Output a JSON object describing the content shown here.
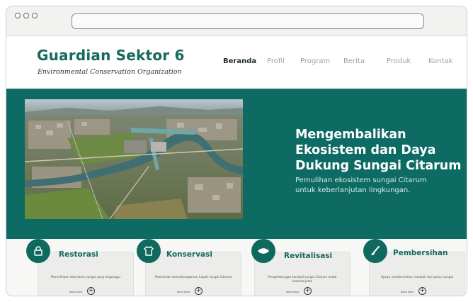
{
  "brand": {
    "title": "Guardian Sektor 6",
    "subtitle": "Environmental Conservation Organization",
    "accent_color": "#17695e"
  },
  "nav": {
    "items": [
      {
        "label": "Beranda",
        "active": true
      },
      {
        "label": "Profil",
        "active": false
      },
      {
        "label": "Program",
        "active": false
      },
      {
        "label": "Berita",
        "active": false
      },
      {
        "label": "Produk",
        "active": false
      },
      {
        "label": "Kontak",
        "active": false
      }
    ]
  },
  "hero": {
    "background_color": "#0d6b64",
    "image_subject": "aerial view of river and city",
    "title_lines": [
      "Mengembalikan",
      "Ekosistem dan Daya",
      "Dukung Sungai Citarum"
    ],
    "subtitle_lines": [
      "Pemulihan ekosistem sungai Citarum",
      "untuk keberlanjutan lingkungan."
    ]
  },
  "services": [
    {
      "icon": "lock-icon",
      "title": "Restorasi",
      "desc": "Memulihkan ekosistem sungai yang terganggu",
      "more": "Read More"
    },
    {
      "icon": "shirt-icon",
      "title": "Konservasi",
      "desc": "Pelestarian keanekaragaman hayati sungai Citarum",
      "more": "Read More"
    },
    {
      "icon": "leaf-icon",
      "title": "Revitalisasi",
      "desc": "Pengembangan kembali sungai Citarum untuk keberlanjutan",
      "more": "Read More"
    },
    {
      "icon": "brush-icon",
      "title": "Pembersihan",
      "desc": "Upaya membersihkan sampah dan polusi sungai",
      "more": "Read More"
    }
  ]
}
